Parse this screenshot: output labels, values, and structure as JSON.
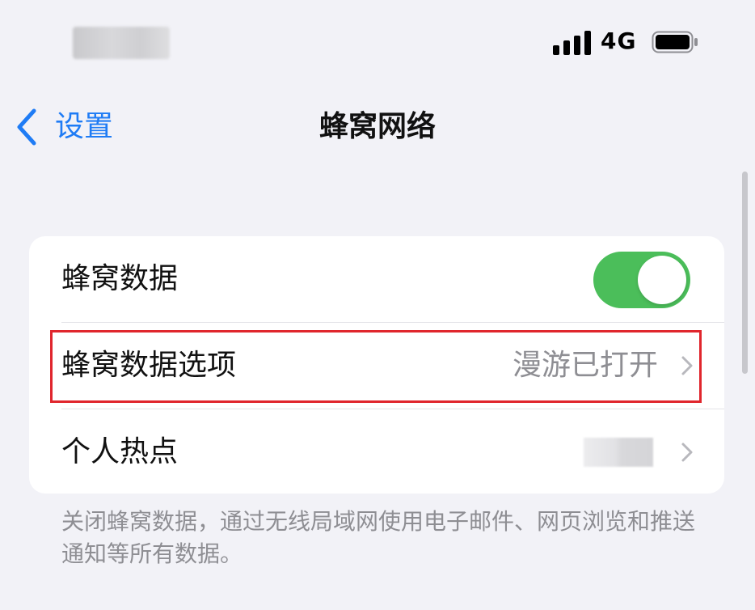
{
  "status_bar": {
    "network": "4G"
  },
  "nav": {
    "back_label": "设置",
    "title": "蜂窝网络"
  },
  "rows": [
    {
      "label": "蜂窝数据",
      "toggle_on": true
    },
    {
      "label": "蜂窝数据选项",
      "value": "漫游已打开"
    },
    {
      "label": "个人热点"
    }
  ],
  "footer": "关闭蜂窝数据，通过无线局域网使用电子邮件、网页浏览和推送通知等所有数据。",
  "colors": {
    "accent": "#1f7cf5",
    "toggle_on": "#4bbe5a",
    "highlight": "#e0262d"
  },
  "icons": [
    "back-chevron-icon",
    "signal-icon",
    "battery-icon",
    "chevron-right-icon"
  ]
}
